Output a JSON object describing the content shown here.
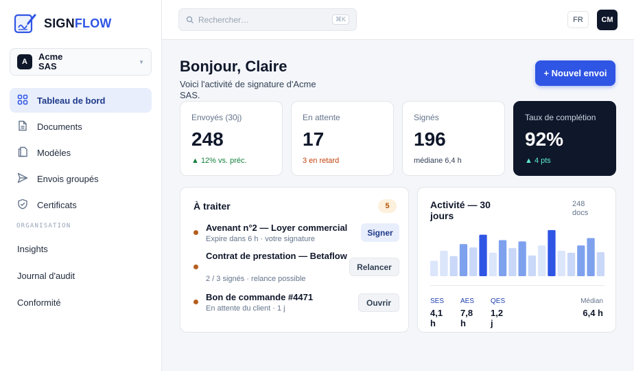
{
  "brand": {
    "name_part1": "SIGN",
    "name_part2": "FLOW"
  },
  "workspace": {
    "initial": "A",
    "name": "Acme SAS"
  },
  "nav": {
    "items": [
      {
        "label": "Tableau de bord",
        "icon": "dashboard-grid-icon",
        "active": true
      },
      {
        "label": "Documents",
        "icon": "document-icon"
      },
      {
        "label": "Modèles",
        "icon": "template-icon"
      },
      {
        "label": "Envois groupés",
        "icon": "send-icon"
      },
      {
        "label": "Certificats",
        "icon": "shield-check-icon"
      }
    ],
    "section_title": "ORGANISATION",
    "org_items": [
      {
        "label": "Insights"
      },
      {
        "label": "Journal d'audit"
      },
      {
        "label": "Conformité"
      }
    ]
  },
  "topbar": {
    "search_placeholder": "Rechercher…",
    "search_shortcut": "⌘K",
    "language": "FR",
    "user_initials": "CM"
  },
  "header": {
    "greeting": "Bonjour, Claire",
    "subtitle": "Voici l'activité de signature d'Acme SAS.",
    "new_button": "+ Nouvel envoi"
  },
  "kpis": [
    {
      "label": "Envoyés (30j)",
      "value": "248",
      "foot": "▲ 12% vs. préc.",
      "tone": "up"
    },
    {
      "label": "En attente",
      "value": "17",
      "foot": "3 en retard",
      "tone": "warn"
    },
    {
      "label": "Signés",
      "value": "196",
      "foot": "médiane 6,4 h",
      "tone": "neutral"
    },
    {
      "label": "Taux de complétion",
      "value": "92%",
      "foot": "▲ 4 pts",
      "tone": "dark"
    }
  ],
  "todo": {
    "title": "À traiter",
    "count": "5",
    "tasks": [
      {
        "name": "Avenant n°2 — Loyer commercial",
        "meta": "Expire dans 6 h · votre signature",
        "action": "Signer"
      },
      {
        "name": "Contrat de prestation — Betaflow",
        "meta": "2 / 3 signés · relance possible",
        "action": "Relancer"
      },
      {
        "name": "Bon de commande #4471",
        "meta": "En attente du client · 1 j",
        "action": "Ouvrir"
      }
    ]
  },
  "activity": {
    "title": "Activité — 30 jours",
    "docs": "248 docs",
    "stats": [
      {
        "label": "SES",
        "value": "4,1 h"
      },
      {
        "label": "AES",
        "value": "7,8 h"
      },
      {
        "label": "QES",
        "value": "1,2 j"
      },
      {
        "label": "Médian",
        "value": "6,4 h"
      }
    ]
  },
  "chart_data": {
    "type": "bar",
    "values": [
      23,
      38,
      30,
      48,
      43,
      62,
      35,
      54,
      42,
      52,
      31,
      46,
      69,
      38,
      35,
      46,
      57,
      36
    ],
    "highlight_color": "#2f55e4",
    "colors": [
      "#dbe6fb",
      "#dbe6fb",
      "#c9d8f8",
      "#7ea1ee",
      "#c9d8f8",
      "#2f55e4",
      "#dbe6fb",
      "#7ea1ee",
      "#c9d8f8",
      "#7ea1ee",
      "#c9d8f8",
      "#dbe6fb",
      "#2f55e4",
      "#dbe6fb",
      "#c9d8f8",
      "#7ea1ee",
      "#7ea1ee",
      "#c9d8f8"
    ],
    "ylim": [
      0,
      75
    ]
  }
}
